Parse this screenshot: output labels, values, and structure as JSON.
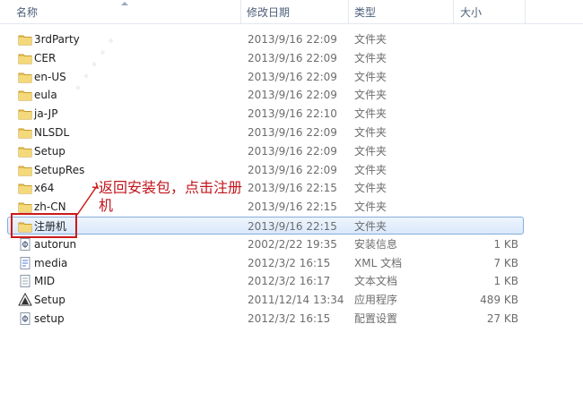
{
  "columns": {
    "name": "名称",
    "date": "修改日期",
    "type": "类型",
    "size": "大小"
  },
  "rows": [
    {
      "name": "3rdParty",
      "date": "2013/9/16 22:09",
      "type": "文件夹",
      "size": "",
      "icon": "folder-icon"
    },
    {
      "name": "CER",
      "date": "2013/9/16 22:09",
      "type": "文件夹",
      "size": "",
      "icon": "folder-icon"
    },
    {
      "name": "en-US",
      "date": "2013/9/16 22:09",
      "type": "文件夹",
      "size": "",
      "icon": "folder-icon"
    },
    {
      "name": "eula",
      "date": "2013/9/16 22:09",
      "type": "文件夹",
      "size": "",
      "icon": "folder-icon"
    },
    {
      "name": "ja-JP",
      "date": "2013/9/16 22:10",
      "type": "文件夹",
      "size": "",
      "icon": "folder-icon"
    },
    {
      "name": "NLSDL",
      "date": "2013/9/16 22:09",
      "type": "文件夹",
      "size": "",
      "icon": "folder-icon"
    },
    {
      "name": "Setup",
      "date": "2013/9/16 22:09",
      "type": "文件夹",
      "size": "",
      "icon": "folder-icon"
    },
    {
      "name": "SetupRes",
      "date": "2013/9/16 22:09",
      "type": "文件夹",
      "size": "",
      "icon": "folder-icon"
    },
    {
      "name": "x64",
      "date": "2013/9/16 22:15",
      "type": "文件夹",
      "size": "",
      "icon": "folder-icon"
    },
    {
      "name": "zh-CN",
      "date": "2013/9/16 22:15",
      "type": "文件夹",
      "size": "",
      "icon": "folder-icon"
    },
    {
      "name": "注册机",
      "date": "2013/9/16 22:15",
      "type": "文件夹",
      "size": "",
      "icon": "folder-icon",
      "selected": true
    },
    {
      "name": "autorun",
      "date": "2002/2/22 19:35",
      "type": "安装信息",
      "size": "1 KB",
      "icon": "settings-file-icon"
    },
    {
      "name": "media",
      "date": "2012/3/2 16:15",
      "type": "XML 文档",
      "size": "7 KB",
      "icon": "document-icon"
    },
    {
      "name": "MID",
      "date": "2012/3/2 16:17",
      "type": "文本文档",
      "size": "1 KB",
      "icon": "text-file-icon"
    },
    {
      "name": "Setup",
      "date": "2011/12/14 13:34",
      "type": "应用程序",
      "size": "489 KB",
      "icon": "app-icon"
    },
    {
      "name": "setup",
      "date": "2012/3/2 16:15",
      "type": "配置设置",
      "size": "27 KB",
      "icon": "settings-file-icon"
    }
  ],
  "annotation": {
    "text": "返回安装包，点击注册机"
  },
  "colors": {
    "annotation": "#c0141b",
    "selection": "#d9e8fb",
    "folder": "#e8c35a"
  }
}
